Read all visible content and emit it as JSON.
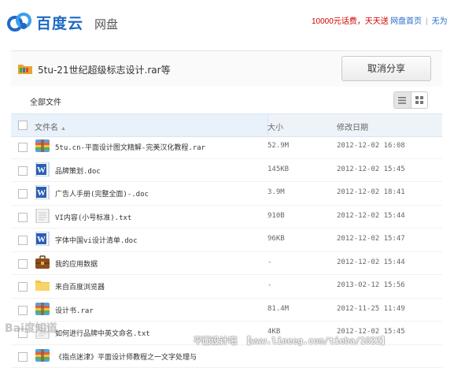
{
  "brand": {
    "name": "百度云",
    "product": "网盘",
    "colors": {
      "primary": "#1e6bc4",
      "promo": "#d40000",
      "link": "#2a6bc9"
    }
  },
  "top": {
    "promo": "10000元话费，天天送",
    "links": [
      "网盘首页",
      "无为"
    ]
  },
  "share": {
    "title": "5tu-21世纪超级标志设计.rar等",
    "cancel_label": "取消分享"
  },
  "breadcrumb": "全部文件",
  "view": {
    "list_icon": "list-view-icon",
    "grid_icon": "grid-view-icon",
    "active": "list"
  },
  "columns": {
    "name": "文件名",
    "size": "大小",
    "date": "修改日期"
  },
  "files": [
    {
      "type": "rar",
      "name": "5tu.cn-平面设计图文精解-完美汉化教程.rar",
      "size": "52.9M",
      "date": "2012-12-02 16:08"
    },
    {
      "type": "doc",
      "name": "品牌策划.doc",
      "size": "145KB",
      "date": "2012-12-02 15:45"
    },
    {
      "type": "doc",
      "name": "广告人手册(完整全面)-.doc",
      "size": "3.9M",
      "date": "2012-12-02 18:41"
    },
    {
      "type": "txt",
      "name": "VI内容(小号标准).txt",
      "size": "910B",
      "date": "2012-12-02 15:44"
    },
    {
      "type": "doc",
      "name": "字体中国vi设计清单.doc",
      "size": "96KB",
      "date": "2012-12-02 15:47"
    },
    {
      "type": "app",
      "name": "我的应用数据",
      "size": "-",
      "date": "2012-12-02 15:44"
    },
    {
      "type": "folder",
      "name": "来自百度浏览器",
      "size": "-",
      "date": "2013-02-12 15:56"
    },
    {
      "type": "rar",
      "name": "设计书.rar",
      "size": "81.4M",
      "date": "2012-11-25 11:49"
    },
    {
      "type": "txt",
      "name": "如何进行品牌中英文命名.txt",
      "size": "4KB",
      "date": "2012-12-02 15:45"
    },
    {
      "type": "rar",
      "name": "《指点迷津》平面设计师教程之一文字处理与",
      "size": "",
      "date": ""
    }
  ],
  "watermarks": {
    "left": "Bai度知道",
    "right": "平面设计吧 【www.lineeg.com/tieba/1822】"
  }
}
